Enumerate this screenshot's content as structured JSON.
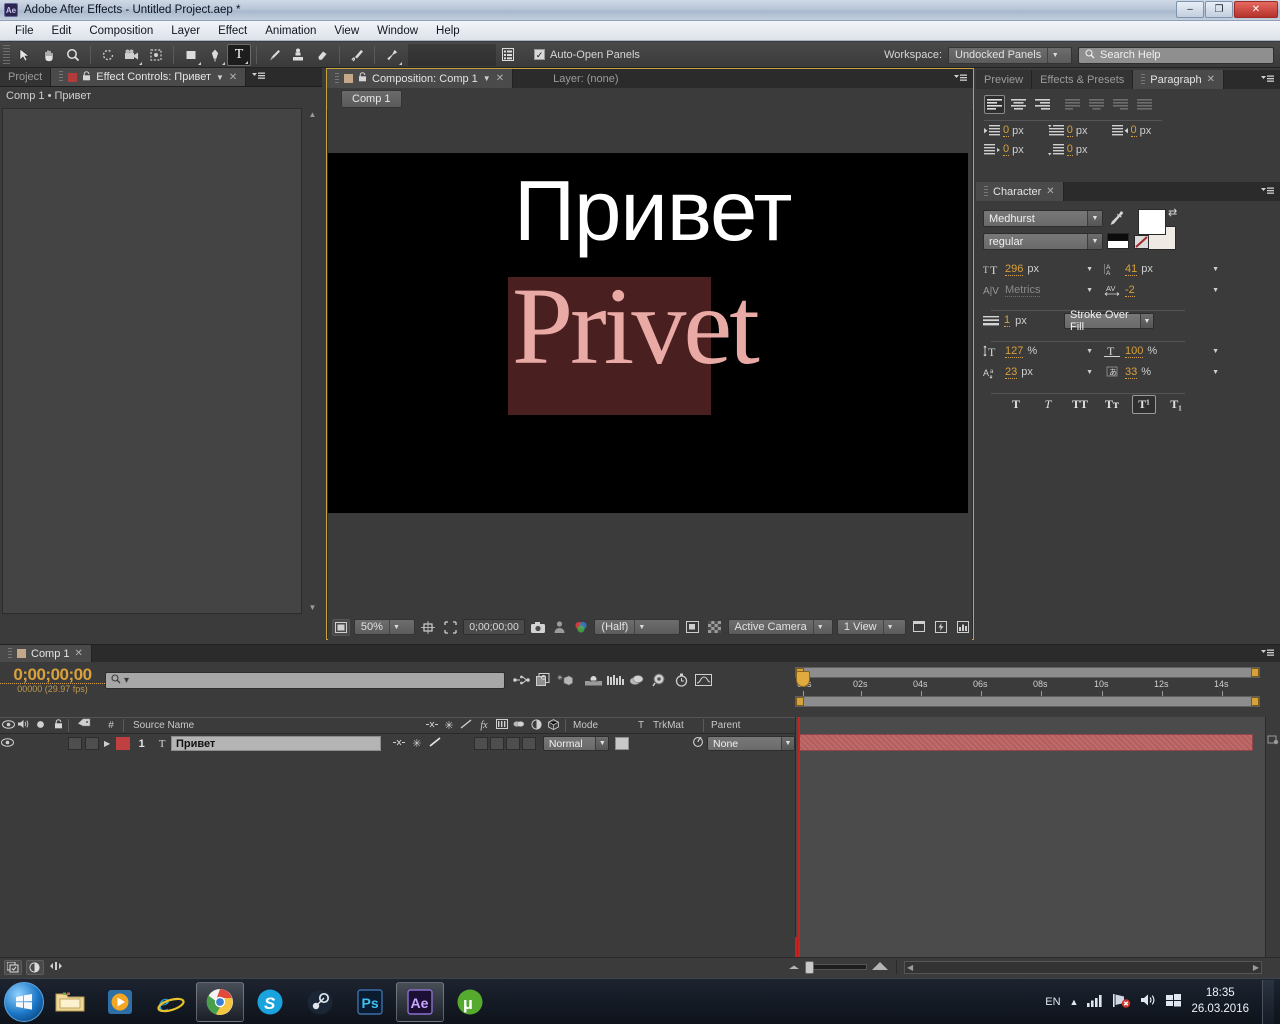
{
  "window": {
    "app_badge": "Ae",
    "title": "Adobe After Effects - Untitled Project.aep *",
    "minimize": "–",
    "maximize": "❐",
    "close": "✕"
  },
  "menubar": {
    "items": [
      "File",
      "Edit",
      "Composition",
      "Layer",
      "Effect",
      "Animation",
      "View",
      "Window",
      "Help"
    ]
  },
  "toolbar": {
    "tools": [
      {
        "name": "selection-tool",
        "glyph": "➤"
      },
      {
        "name": "hand-tool",
        "glyph": "✋"
      },
      {
        "name": "zoom-tool",
        "glyph": "🔍"
      },
      {
        "name": "rotation-tool",
        "glyph": "↻"
      },
      {
        "name": "camera-tool",
        "glyph": "🎥"
      },
      {
        "name": "pan-behind-tool",
        "glyph": "⬚"
      },
      {
        "name": "shape-tool",
        "glyph": "▢"
      },
      {
        "name": "pen-tool",
        "glyph": "✒"
      },
      {
        "name": "type-tool",
        "glyph": "T"
      },
      {
        "name": "brush-tool",
        "glyph": "🖌"
      },
      {
        "name": "clone-stamp-tool",
        "glyph": "⚲"
      },
      {
        "name": "eraser-tool",
        "glyph": "▱"
      },
      {
        "name": "roto-brush-tool",
        "glyph": "✎"
      },
      {
        "name": "puppet-pin-tool",
        "glyph": "📌"
      }
    ],
    "active_tool": "type-tool",
    "panels_icon": "panels-icon",
    "auto_open_label": "Auto-Open Panels",
    "auto_open_checked": true,
    "workspace_label": "Workspace:",
    "workspace_value": "Undocked Panels",
    "search_help_placeholder": "Search Help"
  },
  "effect_controls": {
    "tabs": [
      {
        "label": "Project",
        "active": false
      },
      {
        "label": "Effect Controls: Привет",
        "active": true
      }
    ],
    "path": "Comp 1 • Привет"
  },
  "composition": {
    "tabs": [
      {
        "label": "Composition: Comp 1",
        "active": true
      },
      {
        "label": "Layer: (none)",
        "active": false
      }
    ],
    "comp_button": "Comp 1",
    "canvas": {
      "text_russian": "Привет",
      "text_latin": "Privet",
      "background_color": "#000000",
      "box_color": "#4a1f1f",
      "latin_text_color": "#e9aaa6"
    },
    "bottombar": {
      "zoom": "50%",
      "timecode": "0;00;00;00",
      "resolution": "(Half)",
      "view": "Active Camera",
      "views": "1 View",
      "region_icon": "region-of-interest-icon",
      "grid_icon": "grid-icon",
      "snapshot_icon": "snapshot-icon",
      "mask_icon": "mask-icon",
      "channel_icon": "channel-icon",
      "transparency_icon": "transparency-grid-icon",
      "alpha_icon": "alpha-boundaries-icon",
      "timeline_icon": "timeline-icon",
      "fast_preview_icon": "fast-preview-icon",
      "renderer_icon": "renderer-icon"
    }
  },
  "paragraph": {
    "tabs": [
      {
        "label": "Preview",
        "active": false
      },
      {
        "label": "Effects & Presets",
        "active": false
      },
      {
        "label": "Paragraph",
        "active": true
      }
    ],
    "align_buttons": [
      {
        "name": "align-left",
        "enabled": true,
        "selected": true
      },
      {
        "name": "align-center",
        "enabled": true,
        "selected": false
      },
      {
        "name": "align-right",
        "enabled": true,
        "selected": false
      },
      {
        "name": "justify-last-left",
        "enabled": false,
        "selected": false
      },
      {
        "name": "justify-last-center",
        "enabled": false,
        "selected": false
      },
      {
        "name": "justify-last-right",
        "enabled": false,
        "selected": false
      },
      {
        "name": "justify-all",
        "enabled": false,
        "selected": false
      }
    ],
    "fields": [
      {
        "name": "indent-left",
        "value": "0",
        "unit": "px"
      },
      {
        "name": "indent-first-line",
        "value": "0",
        "unit": "px"
      },
      {
        "name": "indent-right",
        "value": "0",
        "unit": "px"
      },
      {
        "name": "space-before",
        "value": "0",
        "unit": "px"
      },
      {
        "name": "space-after",
        "value": "0",
        "unit": "px"
      }
    ]
  },
  "character": {
    "tab_label": "Character",
    "font_family": "Medhurst",
    "font_style": "regular",
    "eyedropper_icon": "eyedropper-icon",
    "fill_color": "#ffffff",
    "stroke_color": "#ffffff",
    "no_color_icon": "no-fill-icon",
    "swap_icon": "swap-fill-stroke-icon",
    "font_size": {
      "label": "font-size",
      "value": "296",
      "unit": "px"
    },
    "leading": {
      "label": "leading",
      "value": "41",
      "unit": "px"
    },
    "kerning": {
      "label": "kerning",
      "value": "Metrics",
      "unit": ""
    },
    "tracking": {
      "label": "tracking",
      "value": "-2",
      "unit": ""
    },
    "stroke_width": {
      "label": "stroke-width",
      "value": "1",
      "unit": "px"
    },
    "stroke_order": "Stroke Over Fill",
    "vertical_scale": {
      "label": "vertical-scale",
      "value": "127",
      "unit": "%"
    },
    "horizontal_scale": {
      "label": "horizontal-scale",
      "value": "100",
      "unit": "%"
    },
    "baseline_shift": {
      "label": "baseline-shift",
      "value": "23",
      "unit": "px"
    },
    "tsume": {
      "label": "tsume",
      "value": "33",
      "unit": "%"
    },
    "style_buttons": [
      {
        "name": "faux-bold",
        "glyph": "T",
        "selected": false
      },
      {
        "name": "faux-italic",
        "glyph": "T",
        "selected": false
      },
      {
        "name": "all-caps",
        "glyph": "TT",
        "selected": false
      },
      {
        "name": "small-caps",
        "glyph": "Tт",
        "selected": false
      },
      {
        "name": "superscript",
        "glyph": "T¹",
        "selected": true
      },
      {
        "name": "subscript",
        "glyph": "T₁",
        "selected": false
      }
    ]
  },
  "timeline": {
    "tab_label": "Comp 1",
    "current_time": "0;00;00;00",
    "frame_info": "00000 (29.97 fps)",
    "search_placeholder": "",
    "toolbar_icons": [
      "composition-mini-flowchart-icon",
      "draft-3d-icon",
      "hide-shy-layers-icon",
      "enable-frame-blending-icon",
      "enable-motion-blur-icon",
      "brainstorm-icon",
      "graph-editor-icon",
      "auto-keyframe-icon"
    ],
    "column_headers": {
      "eye": "video-switch",
      "audio": "audio-switch",
      "solo": "solo-switch",
      "lock": "lock-switch",
      "label": "label-column",
      "number": "#",
      "source_name": "Source Name",
      "switches": [
        "shy",
        "collapse",
        "quality",
        "fx",
        "frame-blend",
        "motion-blur",
        "adjustment",
        "3d"
      ],
      "mode": "Mode",
      "t": "T",
      "trkmat": "TrkMat",
      "parent": "Parent"
    },
    "layers": [
      {
        "index": "1",
        "type_icon": "T",
        "source_name": "Привет",
        "mode": "Normal",
        "parent": "None",
        "label_color": "#c04040",
        "bar_color": "#b86060"
      }
    ],
    "ruler_labels": [
      "00s",
      "02s",
      "04s",
      "06s",
      "08s",
      "10s",
      "12s",
      "14s"
    ],
    "bottom_icons": [
      "toggle-switches-modes-icon",
      "composition-renderer-icon",
      "stretch-icon"
    ]
  },
  "taskbar": {
    "start": "start-orb",
    "items": [
      {
        "name": "windows-explorer",
        "glyph": "📁",
        "running": false
      },
      {
        "name": "windows-media-player",
        "glyph": "▶",
        "running": false
      },
      {
        "name": "internet-explorer",
        "glyph": "e",
        "running": false
      },
      {
        "name": "google-chrome",
        "glyph": "◎",
        "running": true
      },
      {
        "name": "skype",
        "glyph": "S",
        "running": false
      },
      {
        "name": "steam",
        "glyph": "◈",
        "running": false
      },
      {
        "name": "photoshop",
        "glyph": "Ps",
        "running": false
      },
      {
        "name": "after-effects",
        "glyph": "Ae",
        "running": true
      },
      {
        "name": "utorrent",
        "glyph": "µ",
        "running": false
      }
    ],
    "tray": {
      "language": "EN",
      "show_hidden_icon": "show-hidden-icons-icon",
      "network_icon": "network-signal-icon",
      "network_alert_icon": "network-error-icon",
      "volume_icon": "volume-icon",
      "action_center_icon": "action-center-icon",
      "time": "18:35",
      "date": "26.03.2016"
    }
  }
}
